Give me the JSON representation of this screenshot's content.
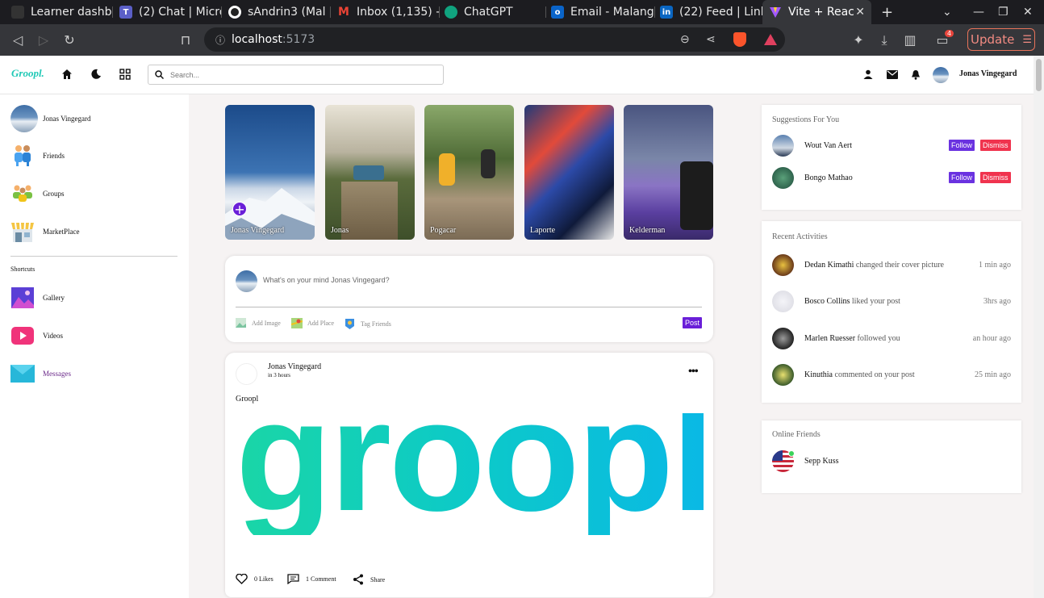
{
  "browser": {
    "tabs": [
      {
        "title": "Learner dashb",
        "fav_color": "#333"
      },
      {
        "title": "(2) Chat | Micro",
        "fav_color": "#5b5fc7"
      },
      {
        "title": "sAndrin3 (Mal",
        "fav_color": "#222"
      },
      {
        "title": "Inbox (1,135) -",
        "fav_color": "#ea4335"
      },
      {
        "title": "ChatGPT",
        "fav_color": "#10a37f"
      },
      {
        "title": "Email - Malang",
        "fav_color": "#0a64c9"
      },
      {
        "title": "(22) Feed | Link",
        "fav_color": "#0a66c2"
      },
      {
        "title": "Vite + Reac",
        "fav_color": "#a259ff",
        "active": true
      }
    ],
    "url_host": "localhost",
    "url_port": ":5173",
    "update_label": "Update",
    "wallet_badge": "4"
  },
  "topnav": {
    "logo": "Groopl.",
    "search_placeholder": "Search...",
    "user_name": "Jonas Vingegard"
  },
  "sidebar": {
    "profile_name": "Jonas Vingegard",
    "items": [
      {
        "label": "Friends",
        "icon": "friends-icon"
      },
      {
        "label": "Groups",
        "icon": "groups-icon"
      },
      {
        "label": "MarketPlace",
        "icon": "marketplace-icon"
      }
    ],
    "shortcuts_heading": "Shortcuts",
    "shortcuts": [
      {
        "label": "Gallery",
        "icon": "gallery-icon"
      },
      {
        "label": "Videos",
        "icon": "videos-icon"
      },
      {
        "label": "Messages",
        "icon": "messages-icon"
      }
    ]
  },
  "stories": [
    {
      "name": "Jonas Vingegard",
      "add": true
    },
    {
      "name": "Jonas"
    },
    {
      "name": "Pogacar"
    },
    {
      "name": "Laporte"
    },
    {
      "name": "Kelderman"
    }
  ],
  "composer": {
    "placeholder": "What's on your mind Jonas Vingegard?",
    "add_image": "Add Image",
    "add_place": "Add Place",
    "tag_friends": "Tag Friends",
    "post_button": "Post"
  },
  "post": {
    "author": "Jonas Vingegard",
    "time": "in 3 hours",
    "text": "Groopl",
    "image_text": "groopl",
    "likes": "0 Likes",
    "comments": "1 Comment",
    "share": "Share"
  },
  "suggestions": {
    "heading": "Suggestions For You",
    "follow_label": "Follow",
    "dismiss_label": "Dismiss",
    "people": [
      {
        "name": "Wout Van Aert"
      },
      {
        "name": "Bongo Mathao"
      }
    ]
  },
  "activities": {
    "heading": "Recent Activities",
    "items": [
      {
        "name": "Dedan Kimathi",
        "action": "changed their cover picture",
        "time": "1 min ago"
      },
      {
        "name": "Bosco Collins",
        "action": "liked your post",
        "time": "3hrs ago"
      },
      {
        "name": "Marlen Ruesser",
        "action": "followed you",
        "time": "an hour ago"
      },
      {
        "name": "Kinuthia",
        "action": "commented on your post",
        "time": "25 min ago"
      }
    ]
  },
  "online": {
    "heading": "Online Friends",
    "friends": [
      {
        "name": "Sepp Kuss"
      }
    ]
  }
}
